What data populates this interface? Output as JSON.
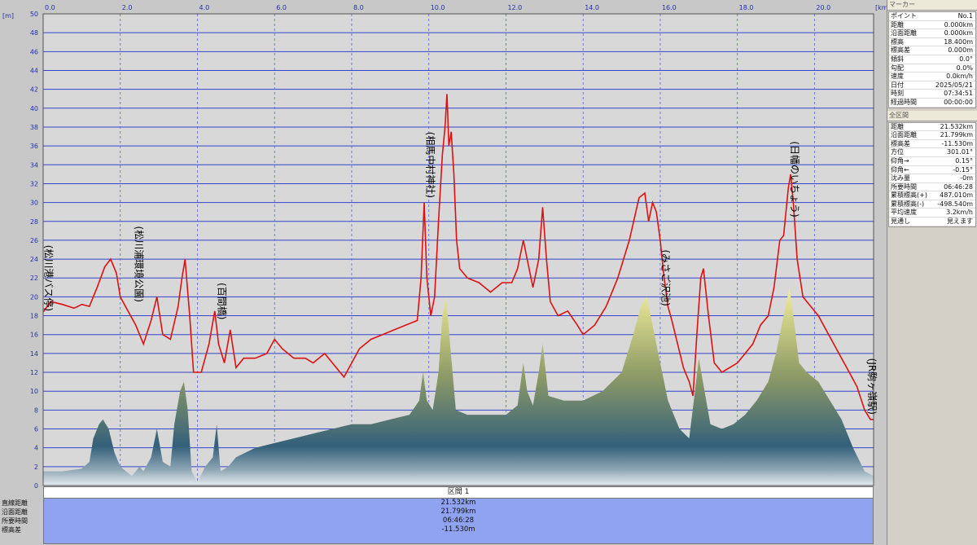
{
  "chart_data": {
    "type": "area",
    "x_unit": "[km]",
    "y_unit": "[m]",
    "xlim": [
      0,
      21.532
    ],
    "ylim": [
      0,
      50
    ],
    "x_ticks": [
      "0.0",
      "2.0",
      "4.0",
      "6.0",
      "8.0",
      "10.0",
      "12.0",
      "14.0",
      "16.0",
      "18.0",
      "20.0"
    ],
    "y_ticks": [
      0,
      2,
      4,
      6,
      8,
      10,
      12,
      14,
      16,
      18,
      20,
      22,
      24,
      26,
      28,
      30,
      32,
      34,
      36,
      38,
      40,
      42,
      44,
      46,
      48,
      50
    ],
    "grid": true,
    "series": [
      {
        "color": "#dd1111",
        "points": [
          [
            0.0,
            18.4
          ],
          [
            0.2,
            19.5
          ],
          [
            0.5,
            19.2
          ],
          [
            0.8,
            18.8
          ],
          [
            1.0,
            19.2
          ],
          [
            1.2,
            19.0
          ],
          [
            1.4,
            21.0
          ],
          [
            1.6,
            23.2
          ],
          [
            1.75,
            24.0
          ],
          [
            1.9,
            22.5
          ],
          [
            2.0,
            20.0
          ],
          [
            2.2,
            18.5
          ],
          [
            2.4,
            17.0
          ],
          [
            2.6,
            15.0
          ],
          [
            2.8,
            17.5
          ],
          [
            2.95,
            20.0
          ],
          [
            3.1,
            16.0
          ],
          [
            3.3,
            15.5
          ],
          [
            3.5,
            19.0
          ],
          [
            3.6,
            22.0
          ],
          [
            3.68,
            24.0
          ],
          [
            3.8,
            18.0
          ],
          [
            3.9,
            12.0
          ],
          [
            4.1,
            12.0
          ],
          [
            4.3,
            15.0
          ],
          [
            4.45,
            18.5
          ],
          [
            4.55,
            15.0
          ],
          [
            4.7,
            13.0
          ],
          [
            4.85,
            16.5
          ],
          [
            5.0,
            12.5
          ],
          [
            5.2,
            13.5
          ],
          [
            5.5,
            13.5
          ],
          [
            5.8,
            14.0
          ],
          [
            6.0,
            15.5
          ],
          [
            6.2,
            14.5
          ],
          [
            6.5,
            13.5
          ],
          [
            6.8,
            13.5
          ],
          [
            7.0,
            13.0
          ],
          [
            7.3,
            14.0
          ],
          [
            7.6,
            12.5
          ],
          [
            7.8,
            11.5
          ],
          [
            8.0,
            13.0
          ],
          [
            8.2,
            14.5
          ],
          [
            8.5,
            15.5
          ],
          [
            8.8,
            16.0
          ],
          [
            9.1,
            16.5
          ],
          [
            9.4,
            17.0
          ],
          [
            9.7,
            17.5
          ],
          [
            9.8,
            22.0
          ],
          [
            9.88,
            30.0
          ],
          [
            9.95,
            22.0
          ],
          [
            10.05,
            18.0
          ],
          [
            10.15,
            20.0
          ],
          [
            10.25,
            28.0
          ],
          [
            10.35,
            35.0
          ],
          [
            10.42,
            38.0
          ],
          [
            10.47,
            41.5
          ],
          [
            10.52,
            36.0
          ],
          [
            10.58,
            37.5
          ],
          [
            10.65,
            33.0
          ],
          [
            10.72,
            26.0
          ],
          [
            10.8,
            23.0
          ],
          [
            11.0,
            22.0
          ],
          [
            11.3,
            21.5
          ],
          [
            11.6,
            20.5
          ],
          [
            11.9,
            21.5
          ],
          [
            12.15,
            21.5
          ],
          [
            12.3,
            23.0
          ],
          [
            12.45,
            26.0
          ],
          [
            12.55,
            24.0
          ],
          [
            12.7,
            21.0
          ],
          [
            12.85,
            24.0
          ],
          [
            12.95,
            29.5
          ],
          [
            13.05,
            24.0
          ],
          [
            13.15,
            19.5
          ],
          [
            13.35,
            18.0
          ],
          [
            13.6,
            18.5
          ],
          [
            13.85,
            17.0
          ],
          [
            14.0,
            16.0
          ],
          [
            14.3,
            17.0
          ],
          [
            14.6,
            19.0
          ],
          [
            14.9,
            22.0
          ],
          [
            15.2,
            26.0
          ],
          [
            15.45,
            30.5
          ],
          [
            15.6,
            31.0
          ],
          [
            15.7,
            28.0
          ],
          [
            15.8,
            30.0
          ],
          [
            15.9,
            29.0
          ],
          [
            16.0,
            26.0
          ],
          [
            16.1,
            22.0
          ],
          [
            16.2,
            19.0
          ],
          [
            16.3,
            17.5
          ],
          [
            16.45,
            15.0
          ],
          [
            16.6,
            12.5
          ],
          [
            16.75,
            11.0
          ],
          [
            16.85,
            9.5
          ],
          [
            16.95,
            16.0
          ],
          [
            17.05,
            22.0
          ],
          [
            17.12,
            23.0
          ],
          [
            17.25,
            18.0
          ],
          [
            17.4,
            13.0
          ],
          [
            17.6,
            12.0
          ],
          [
            17.8,
            12.5
          ],
          [
            18.0,
            13.0
          ],
          [
            18.2,
            14.0
          ],
          [
            18.4,
            15.0
          ],
          [
            18.6,
            17.0
          ],
          [
            18.8,
            18.0
          ],
          [
            18.95,
            21.0
          ],
          [
            19.1,
            26.0
          ],
          [
            19.2,
            26.5
          ],
          [
            19.32,
            31.5
          ],
          [
            19.38,
            33.0
          ],
          [
            19.45,
            30.0
          ],
          [
            19.55,
            24.0
          ],
          [
            19.7,
            20.0
          ],
          [
            19.9,
            19.0
          ],
          [
            20.1,
            18.0
          ],
          [
            20.3,
            16.5
          ],
          [
            20.5,
            15.0
          ],
          [
            20.7,
            13.5
          ],
          [
            20.9,
            12.0
          ],
          [
            21.1,
            10.5
          ],
          [
            21.3,
            8.0
          ],
          [
            21.45,
            7.0
          ],
          [
            21.532,
            7.0
          ]
        ]
      },
      {
        "points": [
          [
            0.0,
            1.5
          ],
          [
            0.5,
            1.5
          ],
          [
            1.0,
            1.8
          ],
          [
            1.2,
            2.5
          ],
          [
            1.3,
            5.0
          ],
          [
            1.45,
            6.5
          ],
          [
            1.55,
            7.0
          ],
          [
            1.7,
            6.0
          ],
          [
            1.85,
            3.5
          ],
          [
            2.0,
            2.0
          ],
          [
            2.3,
            1.0
          ],
          [
            2.5,
            2.0
          ],
          [
            2.6,
            1.5
          ],
          [
            2.8,
            3.0
          ],
          [
            2.95,
            6.0
          ],
          [
            3.1,
            2.5
          ],
          [
            3.3,
            2.0
          ],
          [
            3.4,
            6.5
          ],
          [
            3.55,
            10.0
          ],
          [
            3.65,
            11.0
          ],
          [
            3.75,
            8.0
          ],
          [
            3.85,
            1.5
          ],
          [
            4.0,
            0.3
          ],
          [
            4.2,
            2.0
          ],
          [
            4.4,
            3.0
          ],
          [
            4.5,
            6.5
          ],
          [
            4.6,
            1.5
          ],
          [
            4.8,
            2.0
          ],
          [
            5.0,
            3.0
          ],
          [
            5.5,
            4.0
          ],
          [
            6.0,
            4.5
          ],
          [
            6.5,
            5.0
          ],
          [
            7.0,
            5.5
          ],
          [
            7.5,
            6.0
          ],
          [
            8.0,
            6.5
          ],
          [
            8.5,
            6.5
          ],
          [
            9.0,
            7.0
          ],
          [
            9.5,
            7.5
          ],
          [
            9.75,
            9.0
          ],
          [
            9.85,
            12.0
          ],
          [
            9.95,
            9.0
          ],
          [
            10.1,
            8.0
          ],
          [
            10.25,
            12.0
          ],
          [
            10.35,
            18.0
          ],
          [
            10.45,
            20.0
          ],
          [
            10.55,
            15.0
          ],
          [
            10.7,
            8.0
          ],
          [
            11.0,
            7.5
          ],
          [
            11.5,
            7.5
          ],
          [
            12.0,
            7.5
          ],
          [
            12.3,
            8.5
          ],
          [
            12.45,
            13.0
          ],
          [
            12.55,
            10.0
          ],
          [
            12.7,
            8.5
          ],
          [
            12.85,
            12.0
          ],
          [
            12.95,
            15.0
          ],
          [
            13.1,
            9.5
          ],
          [
            13.5,
            9.0
          ],
          [
            14.0,
            9.0
          ],
          [
            14.5,
            10.0
          ],
          [
            15.0,
            12.0
          ],
          [
            15.3,
            16.0
          ],
          [
            15.5,
            19.0
          ],
          [
            15.65,
            20.0
          ],
          [
            15.8,
            17.0
          ],
          [
            16.0,
            13.0
          ],
          [
            16.2,
            9.0
          ],
          [
            16.5,
            6.0
          ],
          [
            16.75,
            5.0
          ],
          [
            16.9,
            10.0
          ],
          [
            17.0,
            13.5
          ],
          [
            17.15,
            10.0
          ],
          [
            17.3,
            6.5
          ],
          [
            17.6,
            6.0
          ],
          [
            17.9,
            6.5
          ],
          [
            18.2,
            7.5
          ],
          [
            18.5,
            9.0
          ],
          [
            18.8,
            11.0
          ],
          [
            19.0,
            14.0
          ],
          [
            19.2,
            18.0
          ],
          [
            19.35,
            21.0
          ],
          [
            19.45,
            18.0
          ],
          [
            19.6,
            13.0
          ],
          [
            19.8,
            12.0
          ],
          [
            20.1,
            11.0
          ],
          [
            20.4,
            9.0
          ],
          [
            20.7,
            7.0
          ],
          [
            21.0,
            4.0
          ],
          [
            21.3,
            1.5
          ],
          [
            21.532,
            1.0
          ]
        ]
      }
    ],
    "annotations": [
      {
        "text": "(松川港バス停)",
        "x": 0.05,
        "y": 25.5
      },
      {
        "text": "(松川浦環境公園)",
        "x": 2.4,
        "y": 27.5
      },
      {
        "text": "(百間橋)",
        "x": 4.55,
        "y": 21.5
      },
      {
        "text": "(相馬中村神社)",
        "x": 9.95,
        "y": 37.5
      },
      {
        "text": "(みさご沢池)",
        "x": 16.05,
        "y": 25.0
      },
      {
        "text": "(日幡のいちょう)",
        "x": 19.4,
        "y": 36.5
      },
      {
        "text": "(JR駒ヶ嶺駅)",
        "x": 21.45,
        "y": 13.5
      }
    ]
  },
  "marker": {
    "title": "マーカー",
    "rows": [
      {
        "k": "ポイント",
        "v": "No.1"
      },
      {
        "k": "距離",
        "v": "0.000km"
      },
      {
        "k": "沿面距離",
        "v": "0.000km"
      },
      {
        "k": "標高",
        "v": "18.400m"
      },
      {
        "k": "標高差",
        "v": "0.000m"
      },
      {
        "k": "傾斜",
        "v": "0.0°"
      },
      {
        "k": "勾配",
        "v": "0.0%"
      },
      {
        "k": "速度",
        "v": "0.0km/h"
      },
      {
        "k": "日付",
        "v": "2025/05/21"
      },
      {
        "k": "時刻",
        "v": "07:34:51"
      },
      {
        "k": "経過時間",
        "v": "00:00:00"
      }
    ]
  },
  "total": {
    "title": "全区間",
    "rows": [
      {
        "k": "距離",
        "v": "21.532km"
      },
      {
        "k": "沿面距離",
        "v": "21.799km"
      },
      {
        "k": "標高差",
        "v": "-11.530m"
      },
      {
        "k": "方位",
        "v": "301.01°"
      },
      {
        "k": "仰角→",
        "v": "0.15°"
      },
      {
        "k": "仰角←",
        "v": "-0.15°"
      },
      {
        "k": "沈み量",
        "v": "-0m"
      },
      {
        "k": "所要時間",
        "v": "06:46:28"
      },
      {
        "k": "累積標高(+)",
        "v": "487.010m"
      },
      {
        "k": "累積標高(-)",
        "v": "-498.540m"
      },
      {
        "k": "平均速度",
        "v": "3.2km/h"
      },
      {
        "k": "見通し",
        "v": "見えます"
      }
    ]
  },
  "section": {
    "header": "区間 1",
    "labels": [
      "直線距離",
      "沿面距離",
      "所要時間",
      "標高差"
    ],
    "values": [
      "21.532km",
      "21.799km",
      "06:46:28",
      "-11.530m"
    ]
  }
}
